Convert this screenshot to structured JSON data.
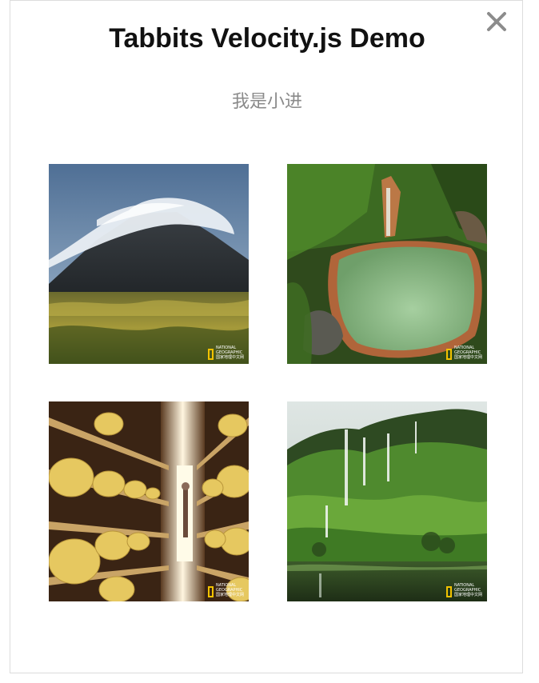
{
  "header": {
    "title": "Tabbits Velocity.js Demo",
    "subtitle": "我是小进"
  },
  "icons": {
    "close": "close-icon"
  },
  "gallery": {
    "photos": [
      {
        "subject": "mountain with lenticular cloud over grassland",
        "watermark": "NATIONAL GEOGRAPHIC 国家地理中文网"
      },
      {
        "subject": "green hot-spring pool with waterfall in forest",
        "watermark": "NATIONAL GEOGRAPHIC 国家地理中文网"
      },
      {
        "subject": "cheese wheels on wooden shelves with person",
        "watermark": "NATIONAL GEOGRAPHIC 国家地理中文网"
      },
      {
        "subject": "green cliffs with waterfalls above lake",
        "watermark": "NATIONAL GEOGRAPHIC 国家地理中文网"
      }
    ],
    "watermark_lines": [
      "NATIONAL",
      "GEOGRAPHIC",
      "国家地理中文网"
    ]
  },
  "colors": {
    "title": "#111111",
    "subtitle": "#8a8a8a",
    "close": "#8c8c8c",
    "border": "#dcdcdc",
    "watermark_frame": "#f2c200"
  }
}
